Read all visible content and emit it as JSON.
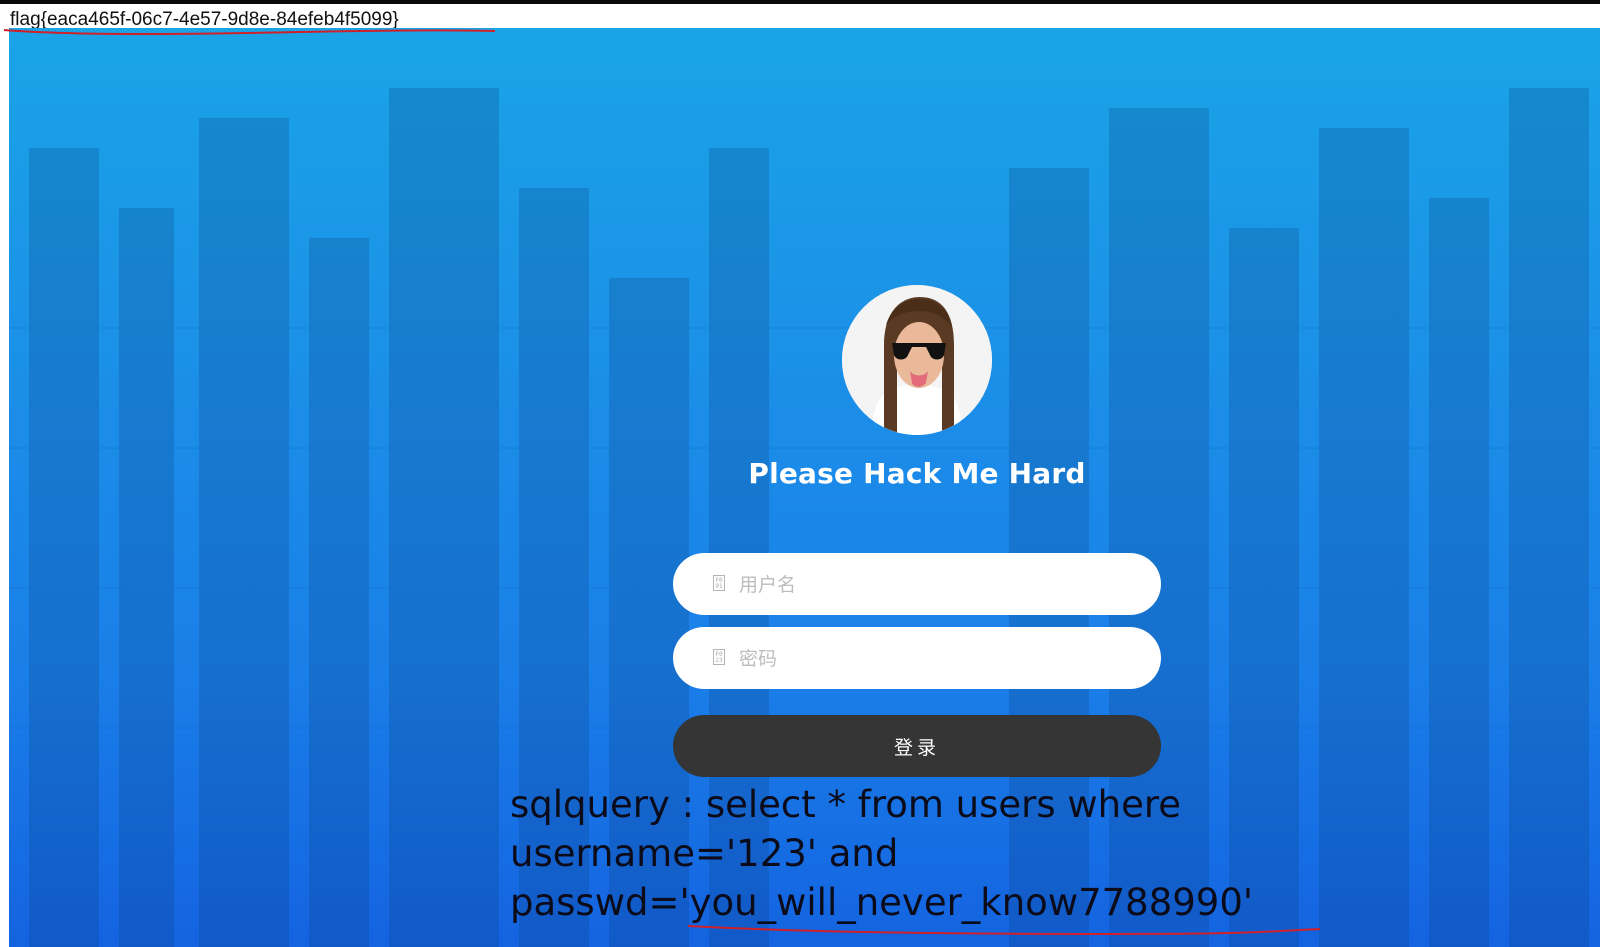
{
  "flag": {
    "text": "flag{eaca465f-06c7-4e57-9d8e-84efeb4f5099}"
  },
  "login": {
    "title": "Please Hack Me Hard",
    "username_placeholder": "用户名",
    "password_placeholder": "密码",
    "username_icon_text": "F0 01",
    "password_icon_text": "F0 23",
    "submit_label": "登录"
  },
  "sql": {
    "line1": "sqlquery : select * from users where",
    "line2": "username='123' and",
    "line3": "passwd='you_will_never_know7788990'"
  },
  "colors": {
    "background_top": "#1aa4e6",
    "background_bottom": "#1463e0",
    "button": "#353535",
    "annotation_underline": "#d0202a"
  },
  "icons": {
    "avatar": "avatar-photo",
    "username_field": "user-icon",
    "password_field": "lock-icon"
  }
}
